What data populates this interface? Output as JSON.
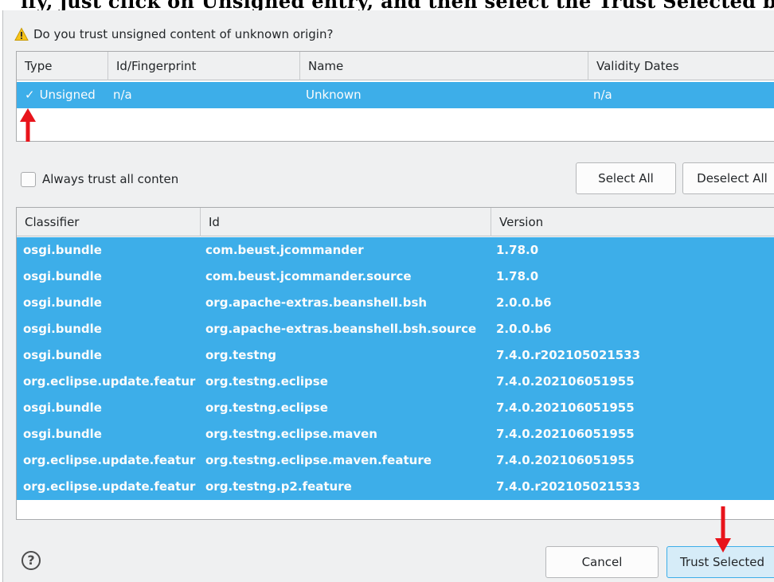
{
  "header_text": "ify, just click on Unsigned entry, and then select the Trust Selected button, to begin installing plugin",
  "dialog": {
    "prompt": "Do you trust unsigned content of unknown origin?",
    "warning_icon": "warning-triangle-icon",
    "trust_table": {
      "columns": [
        "Type",
        "Id/Fingerprint",
        "Name",
        "Validity Dates"
      ],
      "rows": [
        {
          "check": "✓",
          "type": "Unsigned",
          "fingerprint": "n/a",
          "name": "Unknown",
          "validity": "n/a"
        }
      ]
    },
    "always_trust_label": "Always trust all conten",
    "select_all_label": "Select All",
    "deselect_all_label": "Deselect All",
    "units_table": {
      "columns": [
        "Classifier",
        "Id",
        "Version"
      ],
      "rows": [
        {
          "classifier": "osgi.bundle",
          "id": "com.beust.jcommander",
          "version": "1.78.0"
        },
        {
          "classifier": "osgi.bundle",
          "id": "com.beust.jcommander.source",
          "version": "1.78.0"
        },
        {
          "classifier": "osgi.bundle",
          "id": "org.apache-extras.beanshell.bsh",
          "version": "2.0.0.b6"
        },
        {
          "classifier": "osgi.bundle",
          "id": "org.apache-extras.beanshell.bsh.source",
          "version": "2.0.0.b6"
        },
        {
          "classifier": "osgi.bundle",
          "id": "org.testng",
          "version": "7.4.0.r202105021533"
        },
        {
          "classifier": "org.eclipse.update.featur",
          "id": "org.testng.eclipse",
          "version": "7.4.0.202106051955"
        },
        {
          "classifier": "osgi.bundle",
          "id": "org.testng.eclipse",
          "version": "7.4.0.202106051955"
        },
        {
          "classifier": "osgi.bundle",
          "id": "org.testng.eclipse.maven",
          "version": "7.4.0.202106051955"
        },
        {
          "classifier": "org.eclipse.update.featur",
          "id": "org.testng.eclipse.maven.feature",
          "version": "7.4.0.202106051955"
        },
        {
          "classifier": "org.eclipse.update.featur",
          "id": "org.testng.p2.feature",
          "version": "7.4.0.r202105021533"
        }
      ]
    },
    "help_symbol": "?",
    "cancel_label": "Cancel",
    "trust_selected_label": "Trust Selected"
  },
  "colors": {
    "selection": "#3daee9",
    "annotation_arrow": "#e8141b"
  }
}
